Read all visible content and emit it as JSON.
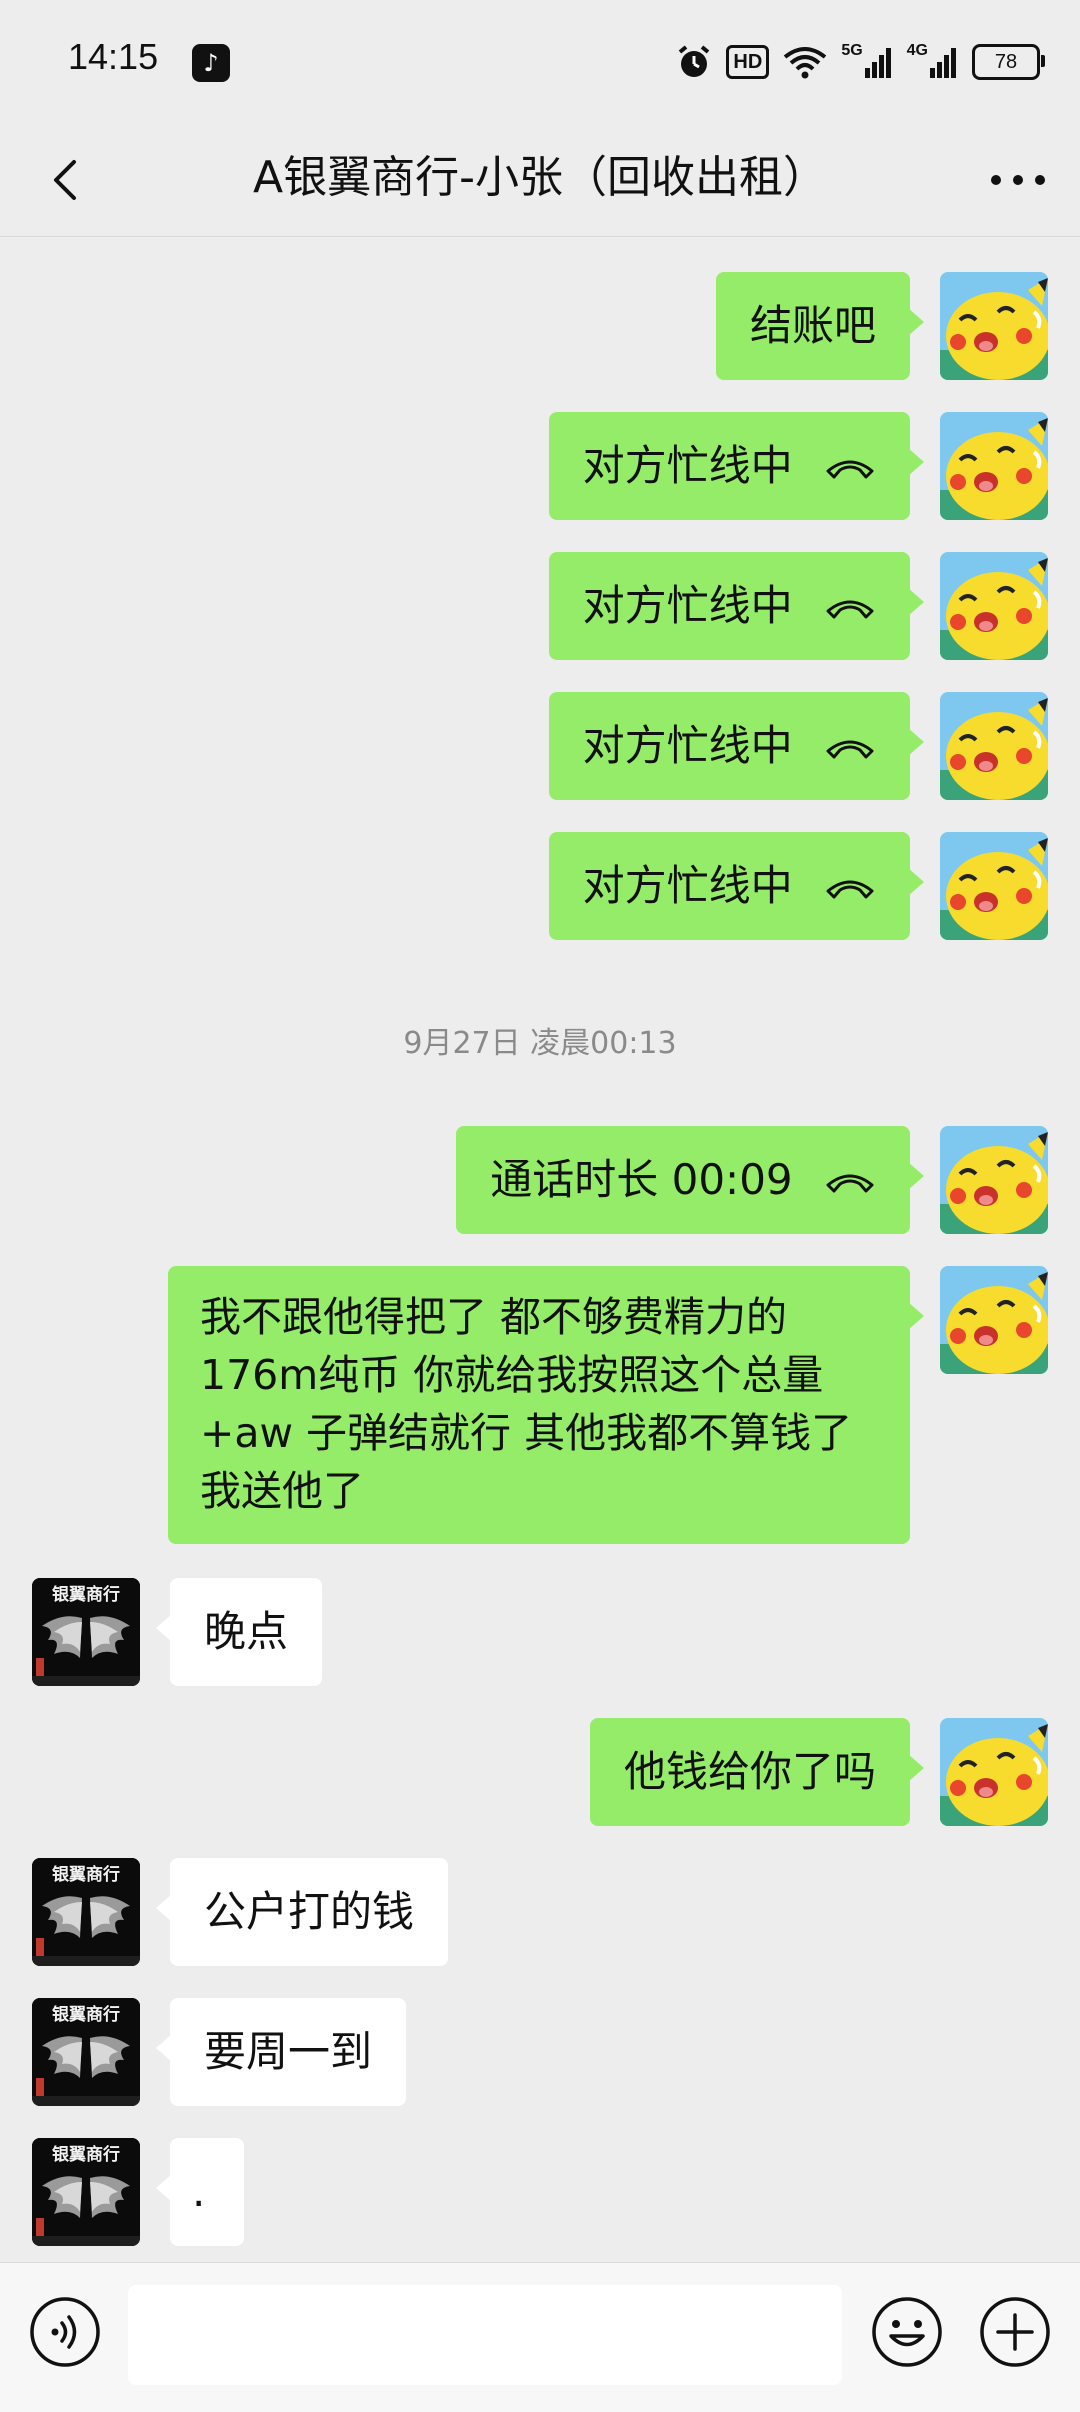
{
  "status_bar": {
    "time": "14:15",
    "app_icon": "tiktok-icon",
    "hd_label": "HD",
    "net_5g": "5G",
    "net_4g": "4G",
    "battery": "78"
  },
  "header": {
    "title": "A银翼商行-小张（回收出租）"
  },
  "timestamp": "9月27日 凌晨00:13",
  "messages": [
    {
      "text": "结账吧"
    },
    {
      "text": "对方忙线中"
    },
    {
      "text": "对方忙线中"
    },
    {
      "text": "对方忙线中"
    },
    {
      "text": "对方忙线中"
    },
    {
      "text": "通话时长 00:09"
    },
    {
      "text": "我不跟他得把了 都不够费精力的 176m纯币 你就给我按照这个总量 +aw 子弹结就行 其他我都不算钱了   我送他了"
    },
    {
      "text": "晚点"
    },
    {
      "text": "他钱给你了吗"
    },
    {
      "text": "公户打的钱"
    },
    {
      "text": "要周一到"
    },
    {
      "text": "."
    }
  ],
  "other_avatar_label": "银翼商行",
  "input": {
    "placeholder": ""
  },
  "colors": {
    "outgoing_bubble": "#95ec69",
    "incoming_bubble": "#ffffff",
    "background": "#ededed"
  }
}
